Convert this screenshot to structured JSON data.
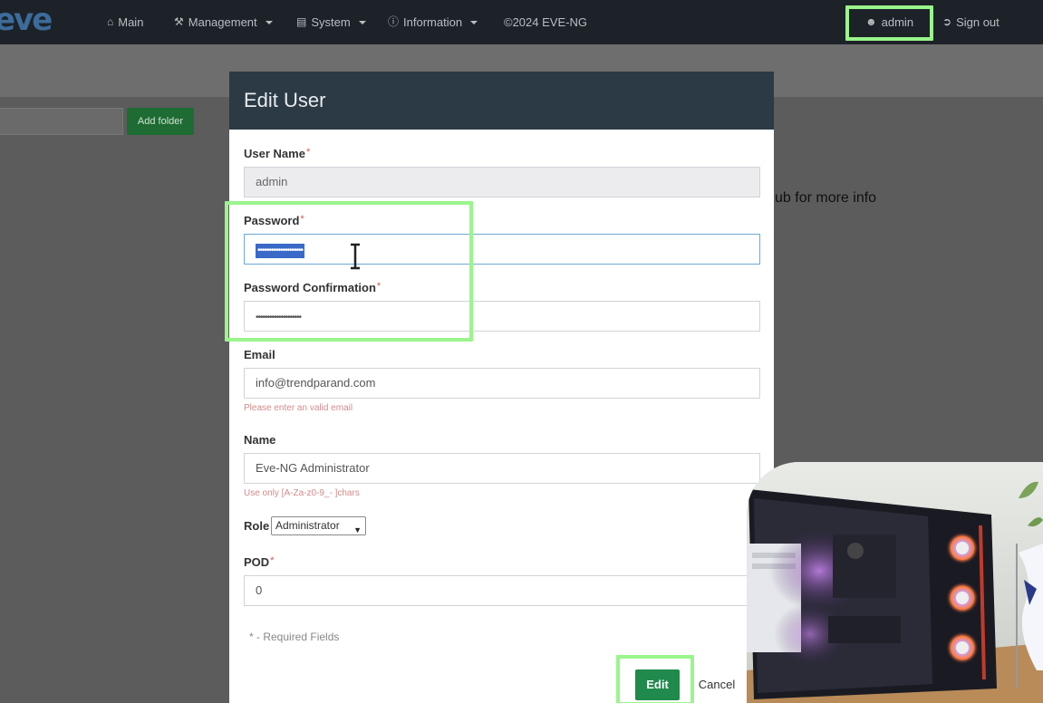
{
  "navbar": {
    "logo": "eve",
    "items": [
      {
        "label": "Main",
        "icon": "home-icon"
      },
      {
        "label": "Management",
        "icon": "wrench-icon"
      },
      {
        "label": "System",
        "icon": "hdd-icon"
      },
      {
        "label": "Information",
        "icon": "info-icon"
      }
    ],
    "copyright": "©2024 EVE-NG",
    "user": "admin",
    "sign_out": "Sign out"
  },
  "background": {
    "add_folder": "Add folder",
    "info_fragment": "ub for more info"
  },
  "modal": {
    "title": "Edit User",
    "username": {
      "label": "User Name",
      "value": "admin"
    },
    "password": {
      "label": "Password",
      "value": "••••••••••••••••••••"
    },
    "password_confirm": {
      "label": "Password Confirmation",
      "value": "••••••••••••••••••••"
    },
    "email": {
      "label": "Email",
      "value": "info@trendparand.com",
      "help": "Please enter an valid email"
    },
    "name": {
      "label": "Name",
      "value": "Eve-NG Administrator",
      "help": "Use only [A-Za-z0-9_- ]chars"
    },
    "role": {
      "label": "Role",
      "value": "Administrator"
    },
    "pod": {
      "label": "POD",
      "value": "0"
    },
    "required_note": "* - Required Fields",
    "edit_button": "Edit",
    "cancel_button": "Cancel",
    "required_marker": "*"
  },
  "colors": {
    "highlight": "#9af58c",
    "navbar_bg": "#1c2228",
    "modal_header_bg": "#2b3a45",
    "edit_button_bg": "#1f8a4c",
    "selection_bg": "#3a6ac8"
  }
}
